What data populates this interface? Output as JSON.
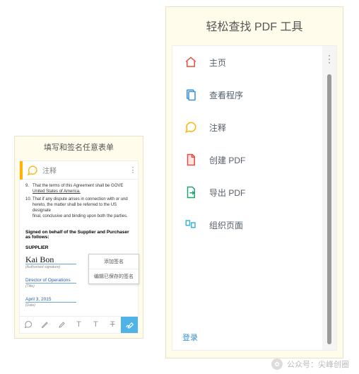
{
  "left": {
    "title": "填写和签名任意表单",
    "tab_label": "注释",
    "clauses": [
      {
        "num": "9.",
        "text_a": "That the terms of this Agreement shall be GOVE",
        "text_b": "United States of America."
      },
      {
        "num": "10.",
        "text_a": "That if any dispute arises in connection with or und",
        "text_b": "hereto, the matter shall be referred to the US designate",
        "text_c": "final, conclusive and binding upon both the parties."
      }
    ],
    "signed_line": "Signed on behalf of the Supplier and Purchaser as follows:",
    "supplier": "SUPPLIER",
    "sig_caption": "(Authorised signature)",
    "title_value": "Director of Operations",
    "title_caption": "(Title)",
    "date_value": "April 3, 2015",
    "date_caption": "(Date)",
    "popup": {
      "add": "添加签名",
      "manage": "编辑已保存的签名"
    }
  },
  "right": {
    "title": "轻松查找 PDF 工具",
    "items": [
      {
        "label": "主页",
        "icon": "home",
        "color": "#e74c3c"
      },
      {
        "label": "查看程序",
        "icon": "view",
        "color": "#3a8fd8"
      },
      {
        "label": "注释",
        "icon": "comment",
        "color": "#ffb400"
      },
      {
        "label": "创建 PDF",
        "icon": "create",
        "color": "#e74c3c"
      },
      {
        "label": "导出 PDF",
        "icon": "export",
        "color": "#1aa86d"
      },
      {
        "label": "组织页面",
        "icon": "organize",
        "color": "#3fb3d8"
      }
    ],
    "login": "登录"
  },
  "wm": {
    "source": "公众号：尖峰创圈"
  }
}
